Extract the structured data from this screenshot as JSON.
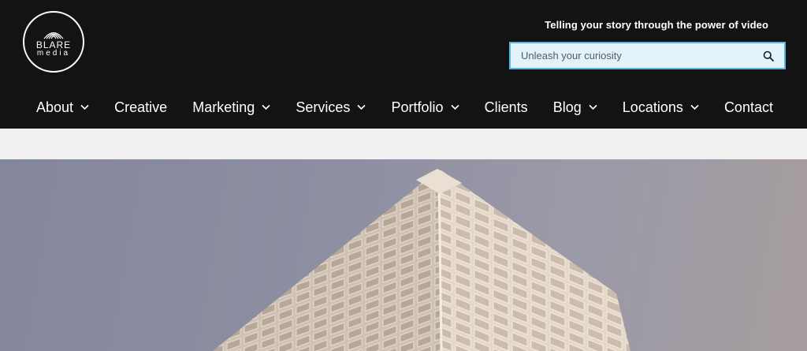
{
  "logo": {
    "brand": "BLARE",
    "sub": "media"
  },
  "header": {
    "tagline": "Telling your story through the power of video"
  },
  "search": {
    "placeholder": "Unleash your curiosity"
  },
  "nav": {
    "items": [
      {
        "label": "About",
        "dropdown": true
      },
      {
        "label": "Creative",
        "dropdown": false
      },
      {
        "label": "Marketing",
        "dropdown": true
      },
      {
        "label": "Services",
        "dropdown": true
      },
      {
        "label": "Portfolio",
        "dropdown": true
      },
      {
        "label": "Clients",
        "dropdown": false
      },
      {
        "label": "Blog",
        "dropdown": true
      },
      {
        "label": "Locations",
        "dropdown": true
      },
      {
        "label": "Contact",
        "dropdown": false
      }
    ]
  },
  "colors": {
    "header_bg": "#141313",
    "search_bg": "#e3f3fc",
    "search_border": "#59b7e3",
    "band": "#f0f0f0"
  }
}
